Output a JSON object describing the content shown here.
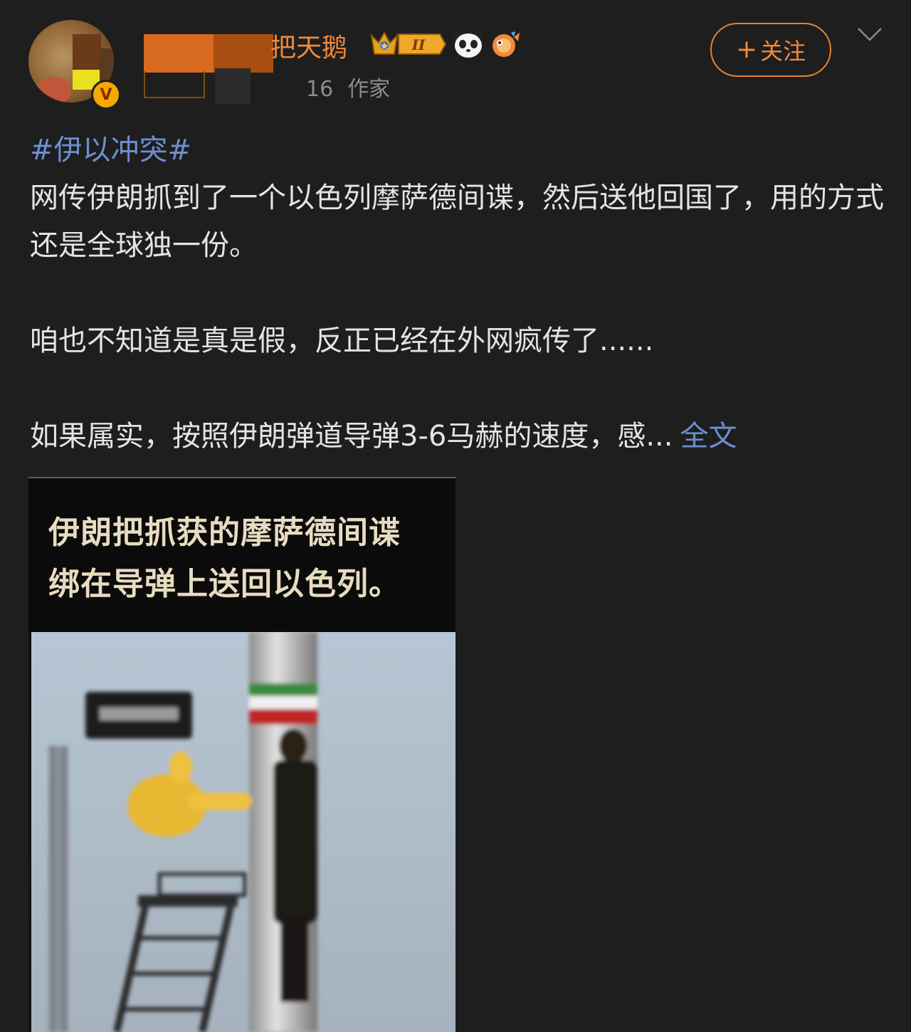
{
  "user": {
    "name": "把天鹅",
    "level": "II",
    "meta_count": "16",
    "meta_role": "作家",
    "verified_mark": "V"
  },
  "follow_button": {
    "plus": "+",
    "label": "关注"
  },
  "post": {
    "hashtag": "#伊以冲突#",
    "paragraph1": "网传伊朗抓到了一个以色列摩萨德间谍，然后送他回国了，用的方式还是全球独一份。",
    "paragraph2": "咱也不知道是真是假，反正已经在外网疯传了......",
    "paragraph3": "如果属实，按照伊朗弹道导弹3-6马赫的速度，感...",
    "more_label": "全文"
  },
  "media": {
    "caption_line1": "伊朗把抓获的摩萨德间谍",
    "caption_line2": "绑在导弹上送回以色列。"
  },
  "colors": {
    "background": "#1e1e1e",
    "accent_orange": "#f08a3c",
    "link_blue": "#6d8ed0",
    "text": "#e4e4e4",
    "muted": "#8c8c8c"
  },
  "icons": [
    "crown-level-badge-icon",
    "panda-icon",
    "fish-icon",
    "chevron-down-icon",
    "verified-badge-icon"
  ]
}
